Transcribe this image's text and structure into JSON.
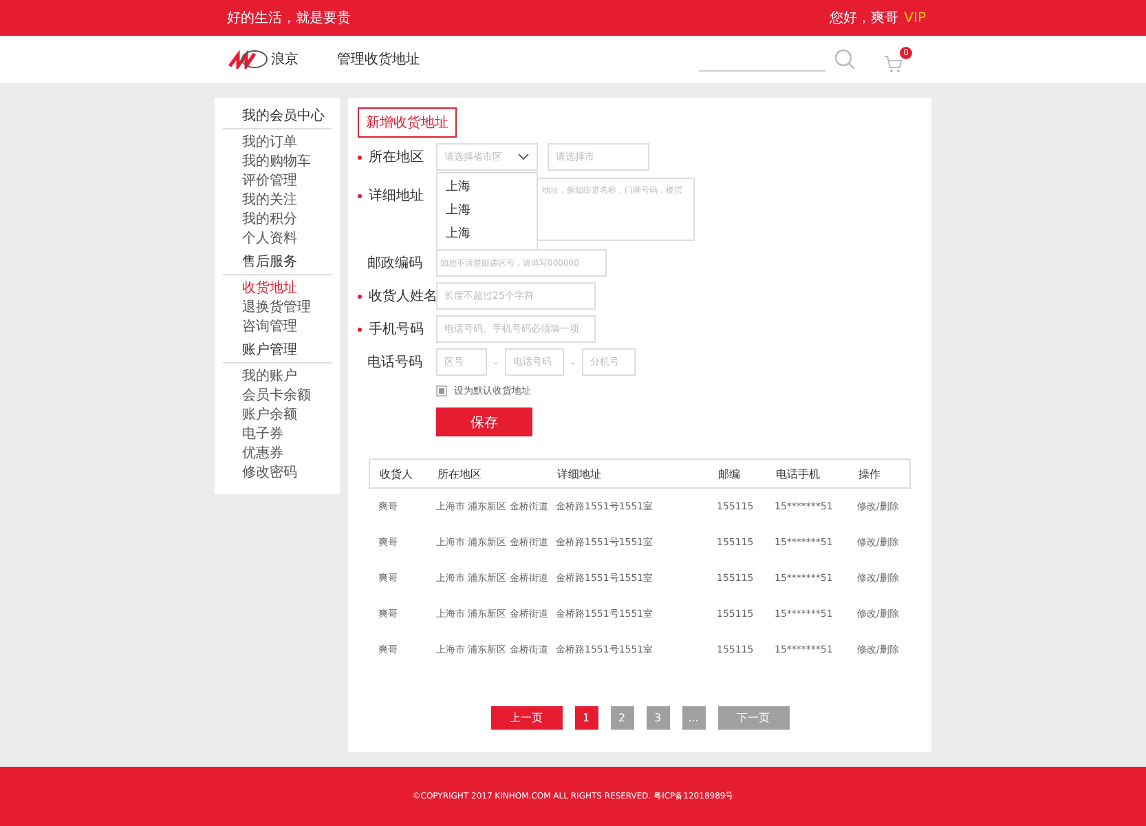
{
  "top_bar": {
    "slogan": "好的生活，就是要贵",
    "greeting": "您好，爽哥",
    "vip": "VIP"
  },
  "header": {
    "logo_text": "浪京",
    "nav": "管理收货地址",
    "cart_count": "0"
  },
  "sidebar": {
    "sections": [
      {
        "title": "我的会员中心",
        "items": [
          {
            "label": "我的订单",
            "selected": false
          },
          {
            "label": "我的购物车",
            "selected": false
          },
          {
            "label": "评价管理",
            "selected": false
          },
          {
            "label": "我的关注",
            "selected": false
          },
          {
            "label": "我的积分",
            "selected": false
          },
          {
            "label": "个人资料",
            "selected": false
          }
        ]
      },
      {
        "title": "售后服务",
        "items": [
          {
            "label": "收货地址",
            "selected": true
          },
          {
            "label": "退换货管理",
            "selected": false
          },
          {
            "label": "咨询管理",
            "selected": false
          }
        ]
      },
      {
        "title": "账户管理",
        "items": [
          {
            "label": "我的账户",
            "selected": false
          },
          {
            "label": "会员卡余额",
            "selected": false
          },
          {
            "label": "账户余额",
            "selected": false
          },
          {
            "label": "电子券",
            "selected": false
          },
          {
            "label": "优惠券",
            "selected": false
          },
          {
            "label": "修改密码",
            "selected": false
          }
        ]
      }
    ]
  },
  "form": {
    "tab": "新增收货地址",
    "region": {
      "label": "所在地区",
      "required": true,
      "province_placeholder": "请选择省市区",
      "city_placeholder": "请选择市",
      "options": [
        "上海",
        "上海",
        "上海"
      ]
    },
    "address": {
      "label": "详细地址",
      "required": true,
      "placeholder": "地址，例如街道名称，门牌号码，楼层"
    },
    "postcode": {
      "label": "邮政编码",
      "required": false,
      "placeholder": "如您不清楚邮递区号，请填写000000"
    },
    "name": {
      "label": "收货人姓名",
      "required": true,
      "placeholder": "长度不超过25个字符"
    },
    "mobile": {
      "label": "手机号码",
      "required": true,
      "placeholder": "电话号码、手机号码必须填一项"
    },
    "phone": {
      "label": "电话号码",
      "required": false,
      "placeholders": [
        "区号",
        "电话号码",
        "分机号"
      ],
      "separator": "-"
    },
    "default_checkbox": {
      "label": "设为默认收货地址",
      "checked": true
    },
    "save": "保存"
  },
  "table": {
    "columns": [
      "收货人",
      "所在地区",
      "详细地址",
      "邮编",
      "电话手机",
      "操作"
    ],
    "rows": [
      [
        "爽哥",
        "上海市 浦东新区 金桥街道",
        "金桥路1551号1551室",
        "155115",
        "15*******51",
        "修改/删除"
      ],
      [
        "爽哥",
        "上海市 浦东新区 金桥街道",
        "金桥路1551号1551室",
        "155115",
        "15*******51",
        "修改/删除"
      ],
      [
        "爽哥",
        "上海市 浦东新区 金桥街道",
        "金桥路1551号1551室",
        "155115",
        "15*******51",
        "修改/删除"
      ],
      [
        "爽哥",
        "上海市 浦东新区 金桥街道",
        "金桥路1551号1551室",
        "155115",
        "15*******51",
        "修改/删除"
      ],
      [
        "爽哥",
        "上海市 浦东新区 金桥街道",
        "金桥路1551号1551室",
        "155115",
        "15*******51",
        "修改/删除"
      ]
    ]
  },
  "pagination": {
    "prev": "上一页",
    "pages": [
      {
        "label": "1",
        "selected": true
      },
      {
        "label": "2",
        "selected": false
      },
      {
        "label": "3",
        "selected": false
      },
      {
        "label": "...",
        "selected": false
      }
    ],
    "next": "下一页"
  },
  "footer": "©COPYRIGHT 2017 KINHOM.COM ALL RIGHTS RESERVED. 粤ICP备12018989号"
}
